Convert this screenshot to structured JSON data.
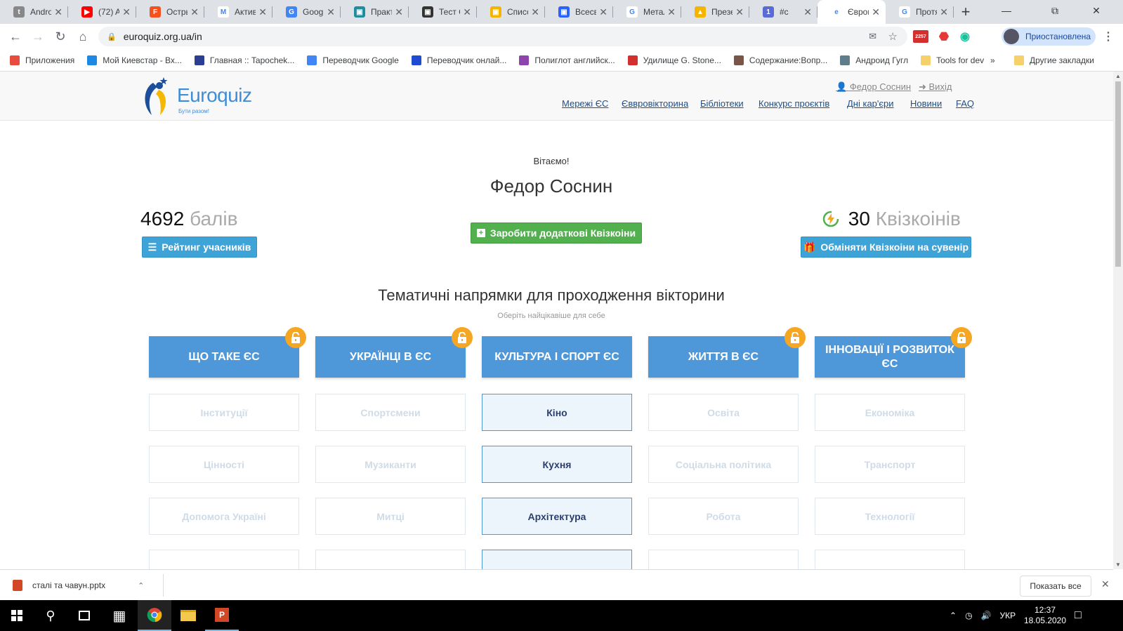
{
  "browser": {
    "tabs": [
      {
        "title": "Andro",
        "color": "#888888",
        "glyph": "t"
      },
      {
        "title": "(72) Al",
        "color": "#ff0000",
        "glyph": "▶"
      },
      {
        "title": "Остры",
        "color": "#f4511e",
        "glyph": "F"
      },
      {
        "title": "Актив",
        "color": "#ffffff",
        "glyph": "M"
      },
      {
        "title": "Googl",
        "color": "#4285f4",
        "glyph": "G"
      },
      {
        "title": "Практ",
        "color": "#1e8e9e",
        "glyph": "▣"
      },
      {
        "title": "Тест С",
        "color": "#333333",
        "glyph": "▣"
      },
      {
        "title": "Списо",
        "color": "#f4b400",
        "glyph": "▣"
      },
      {
        "title": "Всесв",
        "color": "#2962ff",
        "glyph": "▣"
      },
      {
        "title": "Метал",
        "color": "#ffffff",
        "glyph": "G"
      },
      {
        "title": "Презе",
        "color": "#f4b400",
        "glyph": "▲"
      },
      {
        "title": "#с",
        "color": "#5b6bd6",
        "glyph": "1"
      },
      {
        "title": "Єврові",
        "color": "#ffffff",
        "glyph": "e",
        "active": true
      },
      {
        "title": "Протя",
        "color": "#ffffff",
        "glyph": "G"
      }
    ],
    "url": "euroquiz.org.ua/in",
    "profile_label": "Приостановлена",
    "badge_count": "2257",
    "bookmarks": [
      {
        "label": "Приложения",
        "color": "#e74c3c"
      },
      {
        "label": "Мой Киевстар - Вх...",
        "color": "#1e88e5"
      },
      {
        "label": "Главная :: Tapochek...",
        "color": "#2c3e91"
      },
      {
        "label": "Переводчик Google",
        "color": "#4285f4"
      },
      {
        "label": "Переводчик онлай...",
        "color": "#1e4bd2"
      },
      {
        "label": "Полиглот английск...",
        "color": "#8e44ad"
      },
      {
        "label": "Удилище G. Stone...",
        "color": "#d32f2f"
      },
      {
        "label": "Содержание:Вопр...",
        "color": "#795548"
      },
      {
        "label": "Андроид Гугл",
        "color": "#607d8b"
      },
      {
        "label": "Tools for dev",
        "color": "#f6d16b"
      }
    ],
    "other_bookmarks": "Другие закладки",
    "more_glyph": "»"
  },
  "site": {
    "logo_text": "Euroquiz",
    "logo_tagline": "Бути разом!",
    "user_link": "Федор Соснин",
    "logout_link": "Вихід",
    "nav": [
      "Мережі ЄС",
      "Єввровікторина",
      "Бібліотеки",
      "Конкурс проєктів",
      "Дні кар'єри",
      "Новини",
      "FAQ"
    ],
    "welcome": "Вітаємо!",
    "username": "Федор Соснин",
    "score_value": "4692",
    "score_label": "балів",
    "coins_value": "30",
    "coins_label": "Квізкоінів",
    "rating_button": "Рейтинг учасників",
    "earn_button": "Заробити додаткові Квізкоіни",
    "exchange_button": "Обміняти Квізкоіни на сувенір",
    "section_title": "Тематичні напрямки для проходження вікторини",
    "section_subtitle": "Оберіть найцікавіше для себе",
    "categories": [
      {
        "label": "ЩО ТАКЕ ЄС",
        "locked": true,
        "topics": [
          "Інституції",
          "Цінності",
          "Допомога Україні"
        ]
      },
      {
        "label": "УКРАЇНЦІ В ЄС",
        "locked": true,
        "topics": [
          "Спортсмени",
          "Музиканти",
          "Митці"
        ]
      },
      {
        "label": "КУЛЬТУРА І СПОРТ ЄС",
        "locked": false,
        "topics": [
          "Кіно",
          "Кухня",
          "Архітектура"
        ]
      },
      {
        "label": "ЖИТТЯ В ЄС",
        "locked": true,
        "topics": [
          "Освіта",
          "Соціальна політика",
          "Робота"
        ]
      },
      {
        "label": "ІННОВАЦІЇ І РОЗВИТОК ЄС",
        "locked": true,
        "topics": [
          "Економіка",
          "Транспорт",
          "Технології"
        ]
      }
    ]
  },
  "downloads": {
    "file": "сталі та чавун.pptx",
    "show_all": "Показать все"
  },
  "taskbar": {
    "lang": "УКР",
    "time": "12:37",
    "date": "18.05.2020"
  }
}
